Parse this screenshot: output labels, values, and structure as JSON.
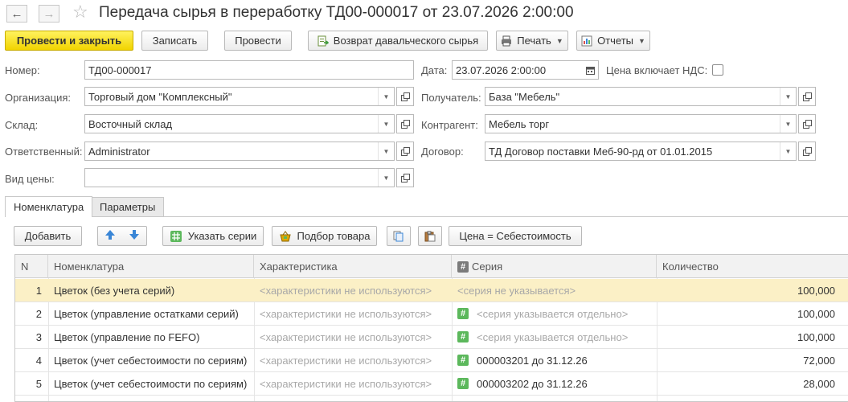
{
  "window": {
    "title": "Передача сырья в переработку ТД00-000017 от 23.07.2026 2:00:00"
  },
  "toolbar": {
    "post_and_close": "Провести и закрыть",
    "save": "Записать",
    "post": "Провести",
    "return_raw": "Возврат давальческого сырья",
    "print": "Печать",
    "reports": "Отчеты"
  },
  "form": {
    "number_label": "Номер:",
    "number_value": "ТД00-000017",
    "date_label": "Дата:",
    "date_value": "23.07.2026  2:00:00",
    "vat_label": "Цена включает НДС:",
    "org_label": "Организация:",
    "org_value": "Торговый дом \"Комплексный\"",
    "recipient_label": "Получатель:",
    "recipient_value": "База \"Мебель\"",
    "warehouse_label": "Склад:",
    "warehouse_value": "Восточный склад",
    "counterparty_label": "Контрагент:",
    "counterparty_value": "Мебель торг",
    "responsible_label": "Ответственный:",
    "responsible_value": "Administrator",
    "contract_label": "Договор:",
    "contract_value": "ТД Договор поставки Меб-90-рд от 01.01.2015",
    "price_type_label": "Вид цены:",
    "price_type_value": ""
  },
  "tabs": [
    {
      "label": "Номенклатура",
      "active": true
    },
    {
      "label": "Параметры",
      "active": false
    }
  ],
  "table_toolbar": {
    "add": "Добавить",
    "specify_series": "Указать серии",
    "pick_goods": "Подбор товара",
    "price_cost": "Цена = Себестоимость"
  },
  "table": {
    "columns": [
      "N",
      "Номенклатура",
      "Характеристика",
      "Серия",
      "Количество"
    ],
    "rows": [
      {
        "n": "1",
        "item": "Цветок (без учета серий)",
        "char": "<характеристики не используются>",
        "series": "<серия не указывается>",
        "series_icon": false,
        "series_grey": true,
        "qty": "100,000",
        "selected": true
      },
      {
        "n": "2",
        "item": "Цветок (управление остатками серий)",
        "char": "<характеристики не используются>",
        "series": "<серия указывается отдельно>",
        "series_icon": true,
        "series_grey": true,
        "qty": "100,000",
        "selected": false
      },
      {
        "n": "3",
        "item": "Цветок (управление по FEFO)",
        "char": "<характеристики не используются>",
        "series": "<серия указывается отдельно>",
        "series_icon": true,
        "series_grey": true,
        "qty": "100,000",
        "selected": false
      },
      {
        "n": "4",
        "item": "Цветок (учет себестоимости по сериям)",
        "char": "<характеристики не используются>",
        "series": "000003201 до 31.12.26",
        "series_icon": true,
        "series_grey": false,
        "qty": "72,000",
        "selected": false
      },
      {
        "n": "5",
        "item": "Цветок (учет себестоимости по сериям)",
        "char": "<характеристики не используются>",
        "series": "000003202 до 31.12.26",
        "series_icon": true,
        "series_grey": false,
        "qty": "28,000",
        "selected": false
      }
    ]
  },
  "icons": {
    "back": "arrow-left-icon",
    "forward": "arrow-right-icon",
    "favorite": "star-icon",
    "calendar": "calendar-icon",
    "open": "open-window-icon",
    "dropdown": "chevron-down-icon",
    "move_up": "arrow-up-icon",
    "move_down": "arrow-down-icon",
    "series": "hash-grid-icon",
    "pick": "basket-icon",
    "copy": "copy-icon",
    "paste": "paste-icon",
    "printer": "printer-icon",
    "report": "chart-icon",
    "return": "return-doc-icon"
  },
  "colors": {
    "primary_button": "#f5dc13",
    "selected_row": "#fbf0c6",
    "series_icon": "#5cb85c",
    "arrow_blue": "#3a86d6"
  }
}
